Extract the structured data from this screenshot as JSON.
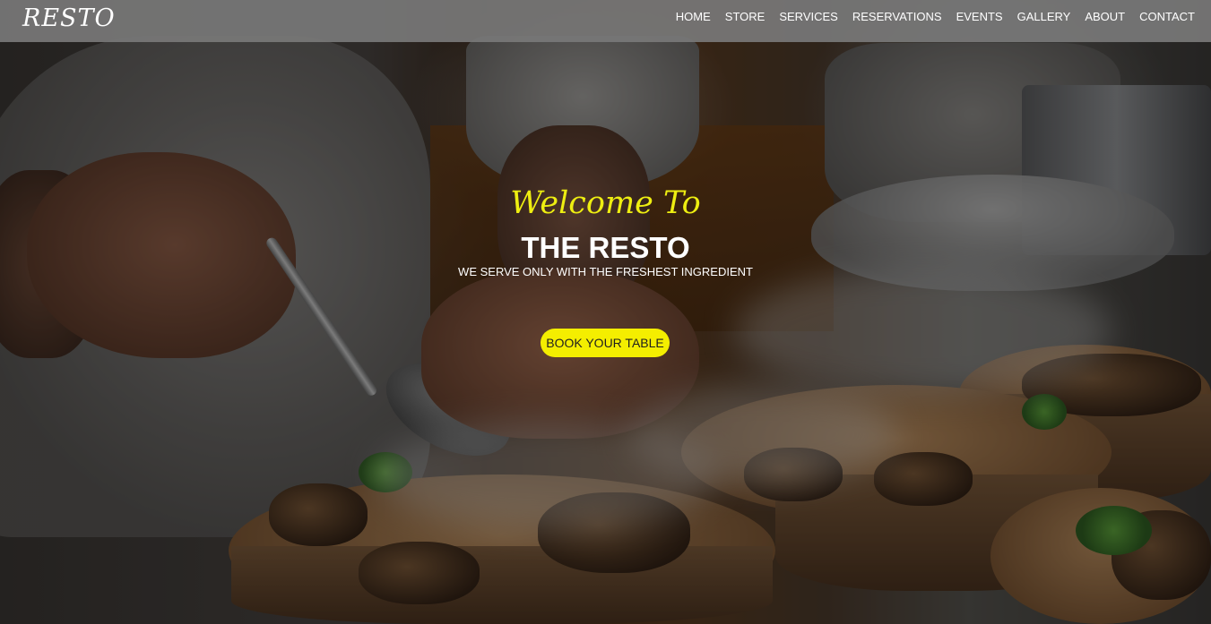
{
  "brand": {
    "logo_text": "RESTO"
  },
  "nav": {
    "items": [
      {
        "label": "HOME"
      },
      {
        "label": "STORE"
      },
      {
        "label": "SERVICES"
      },
      {
        "label": "RESERVATIONS"
      },
      {
        "label": "EVENTS"
      },
      {
        "label": "GALLERY"
      },
      {
        "label": "ABOUT"
      },
      {
        "label": "CONTACT"
      }
    ]
  },
  "hero": {
    "welcome": "Welcome To",
    "title": "THE RESTO",
    "subtitle": "WE SERVE ONLY WITH THE FRESHEST INGREDIENT",
    "cta_label": "BOOK YOUR TABLE"
  },
  "colors": {
    "accent_yellow": "#f4ee00",
    "welcome_text": "#eeee11",
    "nav_background": "#787878",
    "text_white": "#ffffff"
  }
}
